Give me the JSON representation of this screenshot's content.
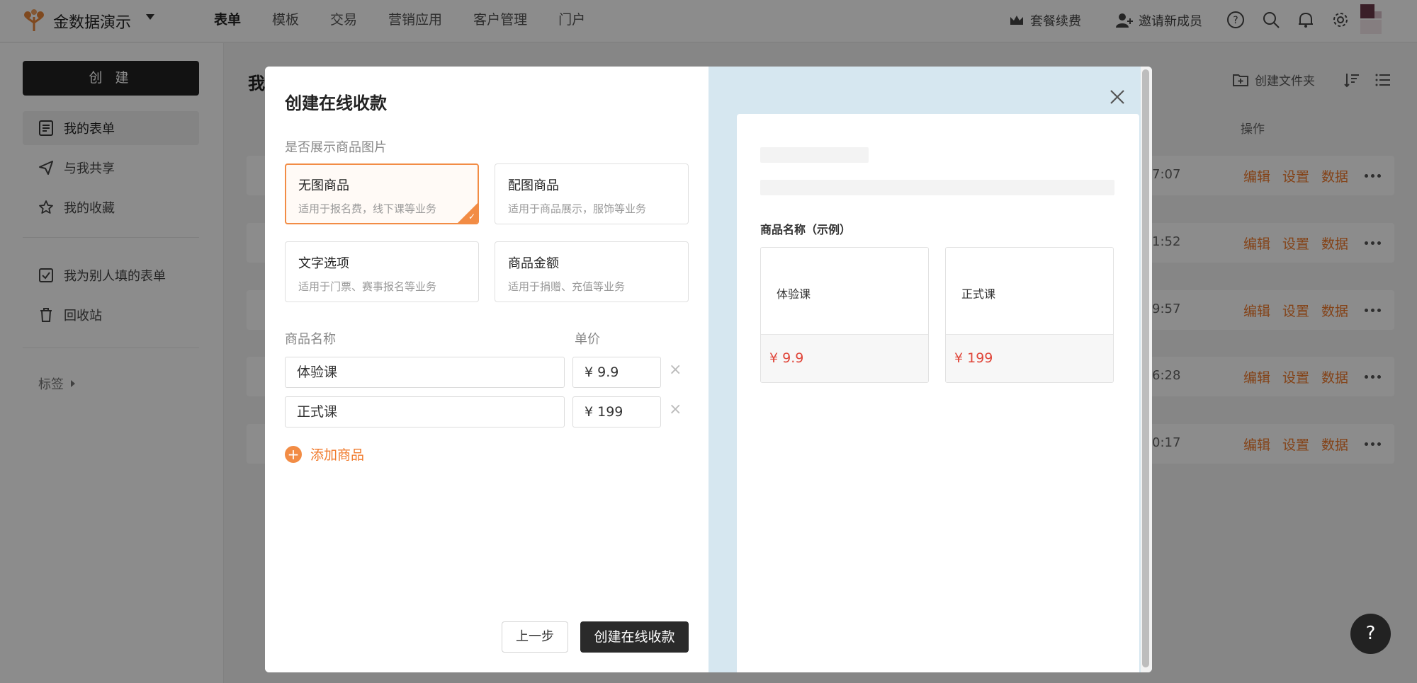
{
  "app": {
    "name": "金数据演示"
  },
  "nav": {
    "items": [
      "表单",
      "模板",
      "交易",
      "营销应用",
      "客户管理",
      "门户"
    ]
  },
  "topbar": {
    "renew": "套餐续费",
    "invite": "邀请新成员"
  },
  "sidebar": {
    "create": "创 建",
    "items": [
      "我的表单",
      "与我共享",
      "我的收藏",
      "我为别人填的表单",
      "回收站"
    ],
    "tags": "标签"
  },
  "main": {
    "title": "我",
    "create_folder": "创建文件夹",
    "ops_header": "操作",
    "row_actions": [
      "编辑",
      "设置",
      "数据"
    ],
    "rows": [
      {
        "time": "7:07"
      },
      {
        "time": "1:52"
      },
      {
        "time": "9:57"
      },
      {
        "time": "6:28"
      },
      {
        "time": "0:17"
      }
    ]
  },
  "modal": {
    "title": "创建在线收款",
    "section_label": "是否展示商品图片",
    "options": [
      {
        "title": "无图商品",
        "desc": "适用于报名费，线下课等业务",
        "selected": true
      },
      {
        "title": "配图商品",
        "desc": "适用于商品展示，服饰等业务",
        "selected": false
      },
      {
        "title": "文字选项",
        "desc": "适用于门票、赛事报名等业务",
        "selected": false
      },
      {
        "title": "商品金额",
        "desc": "适用于捐赠、充值等业务",
        "selected": false
      }
    ],
    "col_name": "商品名称",
    "col_price": "单价",
    "products": [
      {
        "name": "体验课",
        "price": "¥ 9.9"
      },
      {
        "name": "正式课",
        "price": "¥ 199"
      }
    ],
    "remove_symbol": "×",
    "add_label": "添加商品",
    "btn_prev": "上一步",
    "btn_submit": "创建在线收款",
    "preview": {
      "label": "商品名称（示例）",
      "cards": [
        {
          "name": "体验课",
          "price": "¥ 9.9"
        },
        {
          "name": "正式课",
          "price": "¥ 199"
        }
      ]
    }
  },
  "help": "?",
  "colors": {
    "accent": "#f07a2c",
    "price": "#e0463a",
    "preview_bg": "#d6e7f0"
  }
}
